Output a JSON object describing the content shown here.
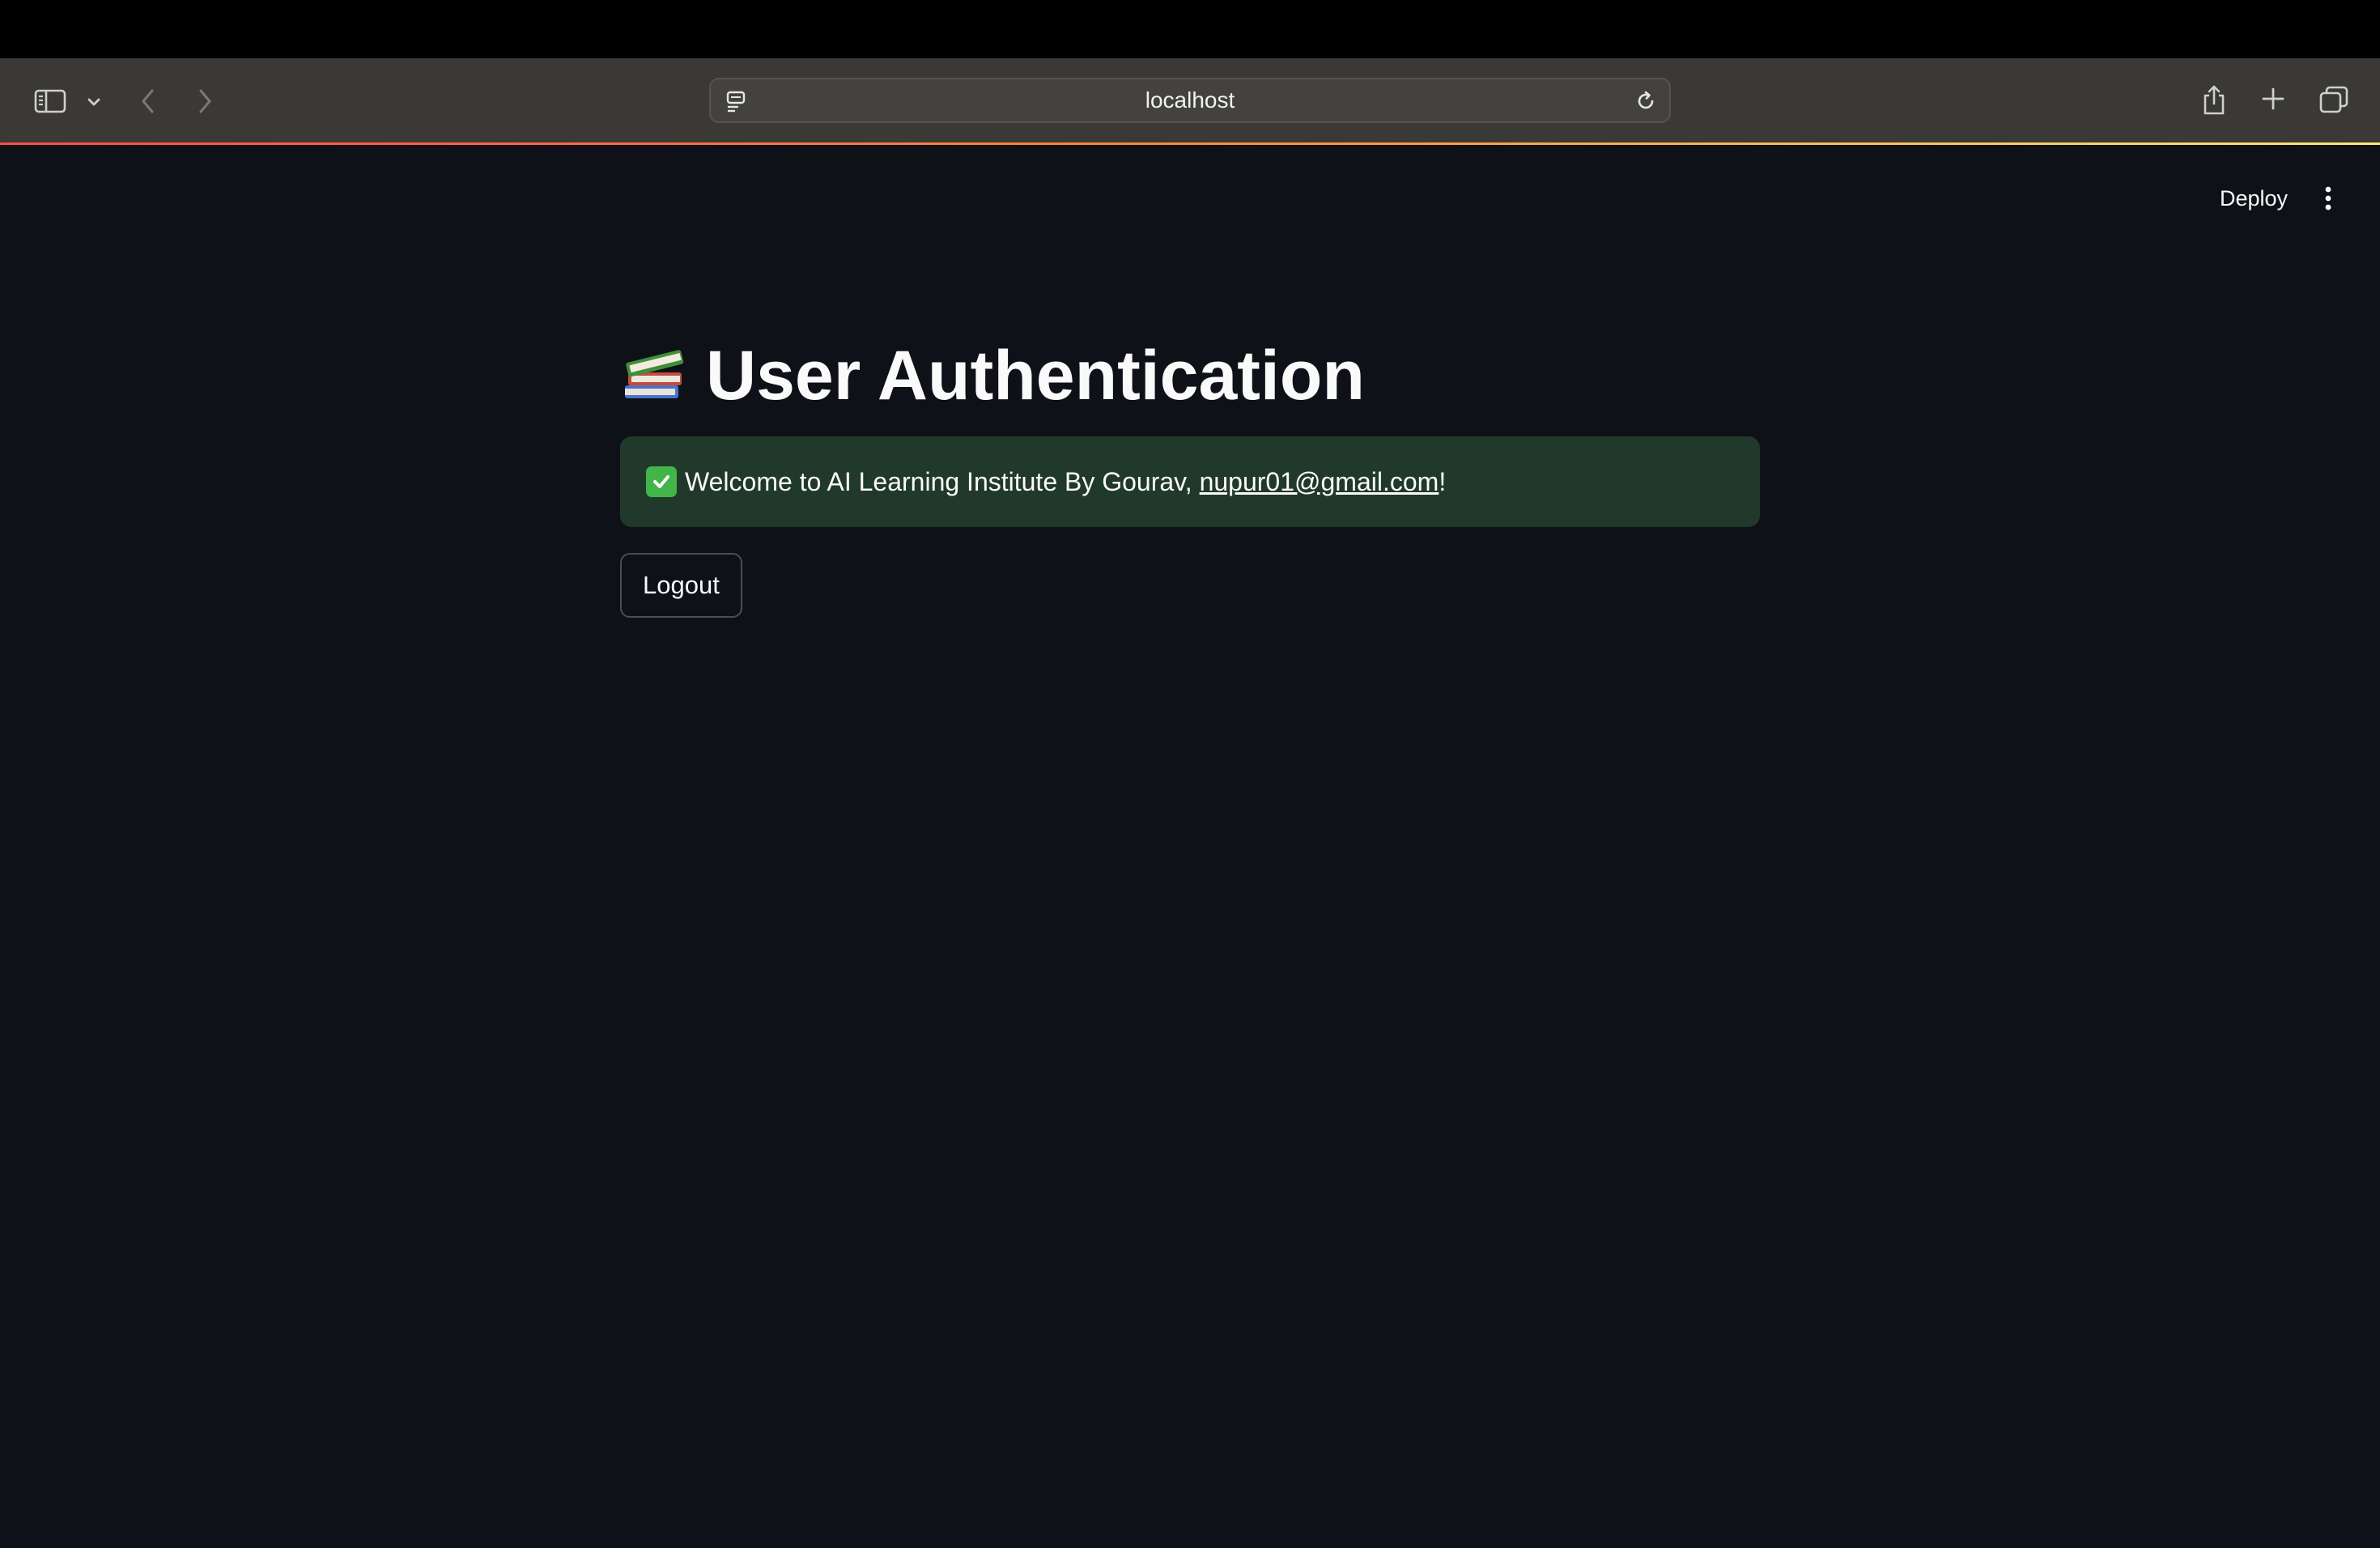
{
  "browser": {
    "url": "localhost",
    "icons": {
      "sidebar": "sidebar-icon",
      "chevron": "chevron-down-icon",
      "back": "back-arrow-icon",
      "forward": "forward-arrow-icon",
      "page": "page-icon",
      "reload": "reload-icon",
      "share": "share-icon",
      "new_tab": "plus-icon",
      "tabs": "tabs-overview-icon"
    }
  },
  "header": {
    "deploy_label": "Deploy",
    "menu_icon": "kebab-menu-icon"
  },
  "main": {
    "title": "User Authentication",
    "title_emoji": "books-emoji",
    "alert": {
      "icon": "check-mark-icon",
      "text_before": "Welcome to AI Learning Institute By Gourav, ",
      "email": "nupur01@gmail.com",
      "text_after": "!",
      "color": "#21392b"
    },
    "logout_label": "Logout"
  },
  "colors": {
    "app_background": "#0e1117",
    "toolbar_background": "#3a3935",
    "text": "#fafafa"
  }
}
